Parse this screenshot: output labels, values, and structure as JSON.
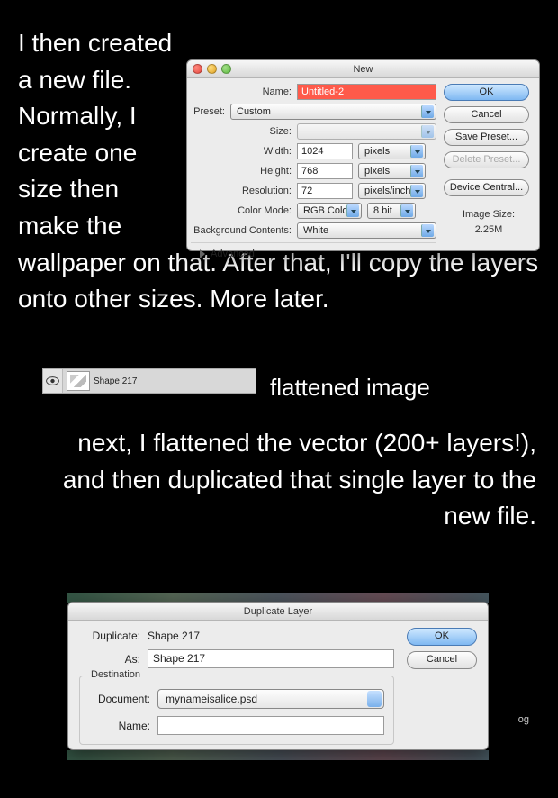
{
  "narrative": {
    "p1": "I then created a new file. Normally, I create one size then make the wallpaper on that. After that, I'll copy the layers onto other sizes. More later.",
    "p1_left": "I then created a new file.\nNormally, I\ncreate one\nsize then\nmake the",
    "p1_wrap_bottom": "wallpaper on that. After that, I'll copy the layers onto other sizes. More later.",
    "flattened_caption": "flattened image",
    "p2": "next, I flattened the vector (200+ layers!), and then duplicated that single layer to the new file."
  },
  "new_dialog": {
    "title": "New",
    "labels": {
      "name": "Name:",
      "preset": "Preset:",
      "size": "Size:",
      "width": "Width:",
      "height": "Height:",
      "resolution": "Resolution:",
      "color_mode": "Color Mode:",
      "bg": "Background Contents:",
      "advanced": "Advanced",
      "image_size": "Image Size:"
    },
    "values": {
      "name": "Untitled-2",
      "preset": "Custom",
      "size": "",
      "width": "1024",
      "width_unit": "pixels",
      "height": "768",
      "height_unit": "pixels",
      "resolution": "72",
      "resolution_unit": "pixels/inch",
      "color_mode": "RGB Color",
      "bit_depth": "8 bit",
      "bg": "White",
      "image_size_value": "2.25M"
    },
    "buttons": {
      "ok": "OK",
      "cancel": "Cancel",
      "save_preset": "Save Preset...",
      "delete_preset": "Delete Preset...",
      "device_central": "Device Central..."
    }
  },
  "layer_row": {
    "name": "Shape 217"
  },
  "duplicate_dialog": {
    "title": "Duplicate Layer",
    "labels": {
      "duplicate": "Duplicate:",
      "as": "As:",
      "destination": "Destination",
      "document": "Document:",
      "name": "Name:"
    },
    "values": {
      "duplicate": "Shape 217",
      "as": "Shape 217",
      "document": "mynameisalice.psd",
      "name": ""
    },
    "buttons": {
      "ok": "OK",
      "cancel": "Cancel"
    }
  },
  "misc": {
    "og_fragment": "og"
  }
}
